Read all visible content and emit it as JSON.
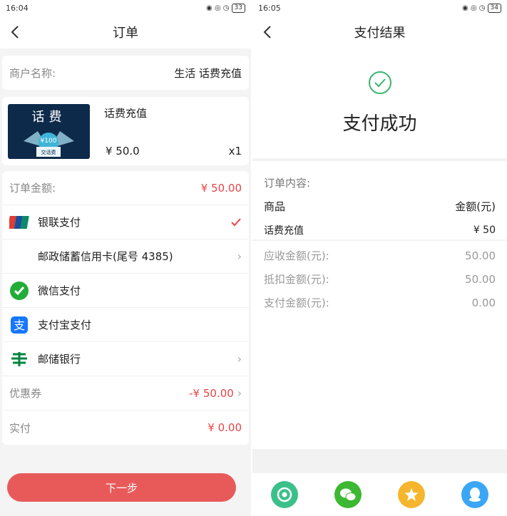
{
  "left": {
    "status": {
      "time": "16:04",
      "signal": "𝑯ıl 𝑯ıl ≈ RDD",
      "battery": "33"
    },
    "title": "订单",
    "merchant": {
      "label": "商户名称:",
      "value": "生活 话费充值"
    },
    "product": {
      "tile_title": "话费",
      "tile_badge": "¥100",
      "tile_sub": "交话费",
      "name": "话费充值",
      "price": "¥ 50.0",
      "qty": "x1"
    },
    "order_amount": {
      "label": "订单金额:",
      "value": "¥ 50.00"
    },
    "payments": [
      {
        "icon": "unionpay-icon",
        "label": "银联支付"
      },
      {
        "label": "邮政储蓄信用卡(尾号 4385)"
      },
      {
        "icon": "wechat-pay-icon",
        "label": "微信支付"
      },
      {
        "icon": "alipay-icon",
        "label": "支付宝支付"
      },
      {
        "icon": "psbc-icon",
        "label": "邮储银行"
      }
    ],
    "coupon": {
      "label": "优惠券",
      "value": "-¥ 50.00"
    },
    "paid": {
      "label": "实付",
      "value": "¥ 0.00"
    },
    "next_button": "下一步",
    "colors": {
      "accent": "#e54545",
      "button": "#e85a5a"
    }
  },
  "right": {
    "status": {
      "time": "16:05",
      "signal": "𝑯ıl 𝑯ıl ≈ RDD",
      "battery": "34"
    },
    "title": "支付结果",
    "success_text": "支付成功",
    "order_content_label": "订单内容:",
    "table_head": {
      "item": "商品",
      "amount": "金额(元)"
    },
    "table_row": {
      "item": "话费充值",
      "amount": "¥ 50"
    },
    "amounts": [
      {
        "label": "应收金额(元):",
        "value": "50.00"
      },
      {
        "label": "抵扣金额(元):",
        "value": "50.00"
      },
      {
        "label": "支付金额(元):",
        "value": "0.00"
      }
    ],
    "share_icons": [
      "camera-share-icon",
      "wechat-share-icon",
      "star-share-icon",
      "qq-share-icon"
    ],
    "colors": {
      "success": "#3cb371"
    }
  }
}
